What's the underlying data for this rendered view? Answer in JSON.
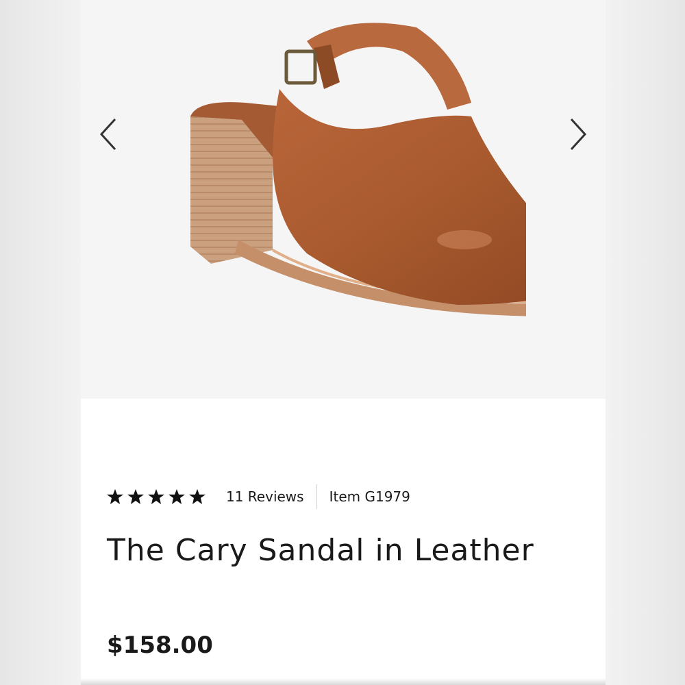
{
  "product": {
    "title": "The Cary Sandal in Leather",
    "reviews_label": "11 Reviews",
    "item_label": "Item G1979",
    "price": "$158.00",
    "rating": 5,
    "rating_max": 5
  },
  "gallery": {
    "prev_icon": "chevron-left-icon",
    "next_icon": "chevron-right-icon",
    "image": "brown-leather-slingback-sandal"
  },
  "colors": {
    "leather": "#a85a2e",
    "heel_wood": "#c99a78",
    "text": "#1a1a1a"
  }
}
